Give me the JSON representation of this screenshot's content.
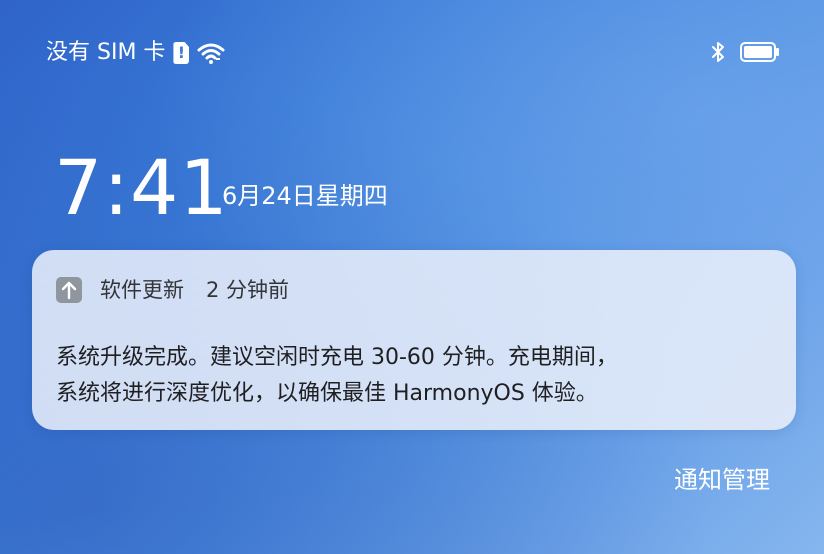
{
  "status_bar": {
    "carrier_text": "没有 SIM 卡",
    "icons": [
      "sim-alert-icon",
      "wifi-icon",
      "bluetooth-icon",
      "battery-icon"
    ]
  },
  "clock": {
    "time": "7:41",
    "date": "6月24日星期四"
  },
  "notification": {
    "app_name": "软件更新",
    "time_ago": "2 分钟前",
    "app_icon": "upload-arrow-icon",
    "body_lines": [
      "系统升级完成。建议空闲时充电 30-60 分钟。充电期间，",
      "系统将进行深度优化，以确保最佳 HarmonyOS 体验。"
    ]
  },
  "actions": {
    "manage_label": "通知管理"
  },
  "colors": {
    "background_start": "#2f63c8",
    "background_end": "#86b6ee",
    "card_background": "#ebf0fa",
    "text_primary": "#ffffff",
    "card_text": "#1f1f22"
  }
}
